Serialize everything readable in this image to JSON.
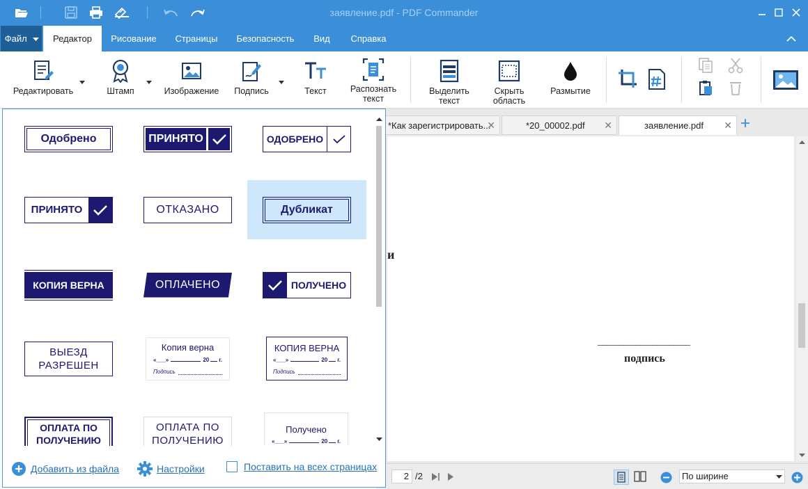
{
  "window": {
    "title": "заявление.pdf - PDF Commander"
  },
  "menu": {
    "file": "Файл",
    "tabs": [
      "Редактор",
      "Рисование",
      "Страницы",
      "Безопасность",
      "Вид",
      "Справка"
    ]
  },
  "ribbon": {
    "edit": "Редактировать",
    "stamp": "Штамп",
    "image": "Изображение",
    "sign": "Подпись",
    "text": "Текст",
    "ocr_line1": "Распознать",
    "ocr_line2": "текст",
    "select_line1": "Выделить",
    "select_line2": "текст",
    "hide_line1": "Скрыть",
    "hide_line2": "область",
    "blur": "Размытие"
  },
  "doc_tabs": [
    {
      "label": "*Как зарегистрировать..."
    },
    {
      "label": "*20_00002.pdf"
    },
    {
      "label": "заявление.pdf"
    }
  ],
  "document": {
    "fragment_char": "и",
    "signature_line": "______________________",
    "signature_label": "подпись"
  },
  "status": {
    "page_current": "2",
    "page_total": "/2",
    "zoom_mode": "По ширине"
  },
  "stamps": {
    "approved": "Одобрено",
    "accepted": "ПРИНЯТО",
    "approved_caps": "ОДОБРЕНО",
    "accepted2": "ПРИНЯТО",
    "rejected": "ОТКАЗАНО",
    "duplicate": "Дубликат",
    "copy_true": "КОПИЯ ВЕРНА",
    "paid": "ОПЛАЧЕНО",
    "received": "ПОЛУЧЕНО",
    "exit_line1": "ВЫЕЗД",
    "exit_line2": "РАЗРЕШЕН",
    "copy_form_title": "Копия верна",
    "copy_form_title_caps": "КОПИЯ ВЕРНА",
    "date_left": "«___»",
    "date_year": "20",
    "date_year_suffix": "г.",
    "signature": "Подпись",
    "pay_line1": "ОПЛАТА ПО",
    "pay_line2": "ПОЛУЧЕНИЮ",
    "received_form_title": "Получено"
  },
  "panel_footer": {
    "add_from_file": "Добавить из файла",
    "settings": "Настройки",
    "all_pages": "Поставить на всех страницах"
  },
  "colors": {
    "accent": "#3a8fd8",
    "stamp_ink": "#1d1870",
    "selected": "#cfe7fb"
  }
}
